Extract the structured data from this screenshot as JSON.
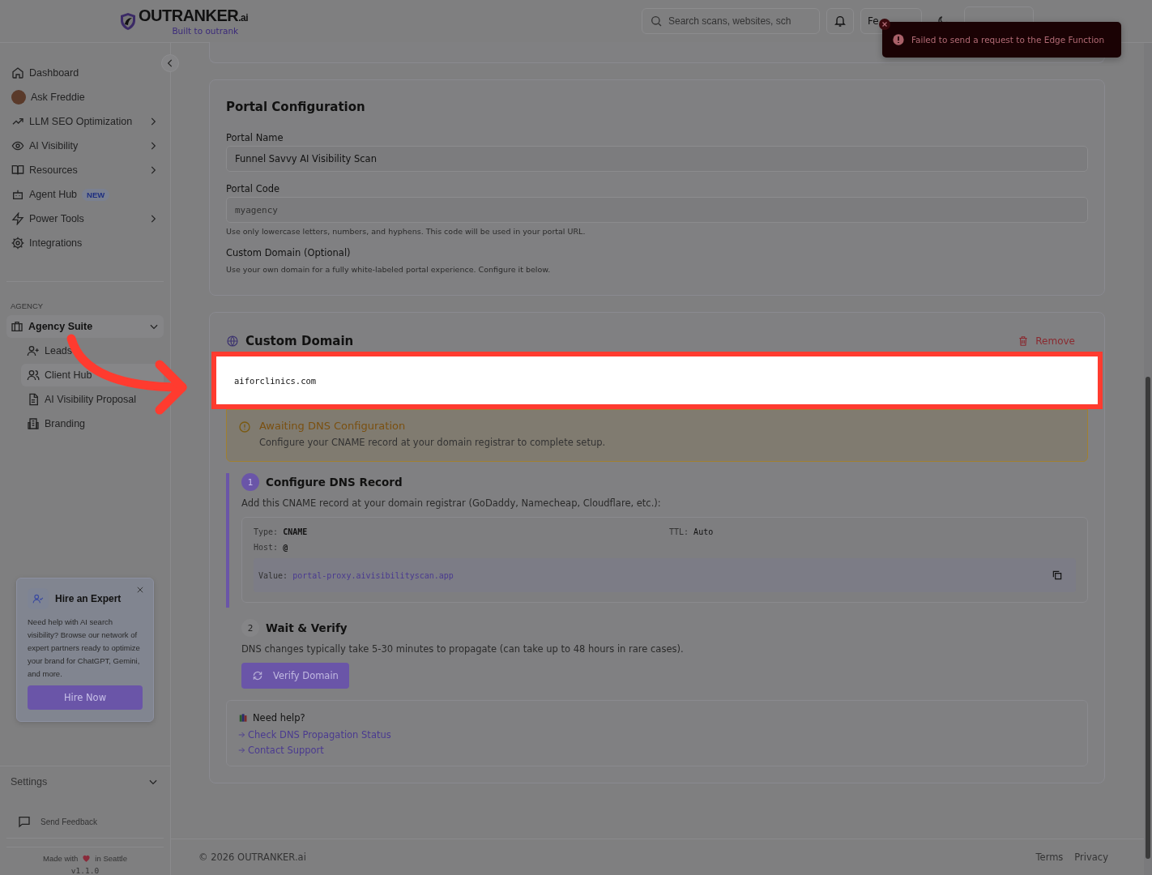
{
  "header": {
    "logo": {
      "name": "OUTRANKER",
      "suffix": ".ai",
      "tagline": "Built to outrank"
    },
    "search": {
      "placeholder": "Search scans, websites, sch"
    },
    "feedback_button": "Fe"
  },
  "toast": {
    "message": "Failed to send a request to the Edge Function"
  },
  "sidebar": {
    "items": [
      {
        "label": "Dashboard",
        "kind": "home",
        "has_submenu": false
      },
      {
        "label": "Ask Freddie",
        "kind": "avatar",
        "has_submenu": false
      },
      {
        "label": "LLM SEO Optimization",
        "kind": "trend",
        "has_submenu": true
      },
      {
        "label": "AI Visibility",
        "kind": "eye",
        "has_submenu": true
      },
      {
        "label": "Resources",
        "kind": "book",
        "has_submenu": true
      },
      {
        "label": "Agent Hub",
        "kind": "robot",
        "has_submenu": false,
        "badge": "NEW"
      },
      {
        "label": "Power Tools",
        "kind": "bolt",
        "has_submenu": true
      },
      {
        "label": "Integrations",
        "kind": "gear",
        "has_submenu": false
      }
    ],
    "section_title": "AGENCY",
    "group": {
      "label": "Agency Suite",
      "expanded": true,
      "children": [
        {
          "label": "Leads",
          "kind": "user-plus",
          "selected": false
        },
        {
          "label": "Client Hub",
          "kind": "users",
          "selected": true
        },
        {
          "label": "AI Visibility Proposal",
          "kind": "file",
          "selected": false
        },
        {
          "label": "Branding",
          "kind": "building",
          "selected": false
        }
      ]
    },
    "promo": {
      "title": "Hire an Expert",
      "text": "Need help with AI search visibility? Browse our network of expert partners ready to optimize your brand for ChatGPT, Gemini, and more.",
      "button": "Hire Now"
    },
    "settings": {
      "label": "Settings",
      "expanded": false
    },
    "send_feedback": "Send Feedback",
    "made_with": {
      "before": "Made with",
      "after": "in Seattle",
      "version": "v1.1.0"
    }
  },
  "portal_config": {
    "title": "Portal Configuration",
    "fields": [
      {
        "label": "Portal Name",
        "value": "Funnel Savvy AI Visibility Scan",
        "mono": false
      },
      {
        "label": "Portal Code",
        "placeholder": "myagency",
        "mono": true,
        "hint": "Use only lowercase letters, numbers, and hyphens. This code will be used in your portal URL."
      }
    ],
    "custom_domain_label": "Custom Domain (Optional)",
    "custom_domain_hint": "Use your own domain for a fully white-labeled portal experience. Configure it below."
  },
  "custom_domain": {
    "title": "Custom Domain",
    "remove": "Remove",
    "domain": "aiforclinics.com",
    "alert": {
      "title": "Awaiting DNS Configuration",
      "text": "Configure your CNAME record at your domain registrar to complete setup."
    },
    "steps": [
      {
        "number": "1",
        "title": "Configure DNS Record",
        "text": "Add this CNAME record at your domain registrar (GoDaddy, Namecheap, Cloudflare, etc.):",
        "active": true
      },
      {
        "number": "2",
        "title": "Wait & Verify",
        "text": "DNS changes typically take 5-30 minutes to propagate (can take up to 48 hours in rare cases).",
        "active": false
      }
    ],
    "record": {
      "type_label": "Type:",
      "type": "CNAME",
      "ttl_label": "TTL:",
      "ttl": "Auto",
      "host_label": "Host:",
      "host": "@",
      "value_label": "Value:",
      "value": "portal-proxy.aivisibilityscan.app"
    },
    "verify_button": "Verify Domain",
    "help": {
      "title": "Need help?",
      "links": [
        "Check DNS Propagation Status",
        "Contact Support"
      ]
    }
  },
  "footer": {
    "copyright": "© 2026 OUTRANKER.ai",
    "links": [
      "Terms",
      "Privacy"
    ]
  }
}
